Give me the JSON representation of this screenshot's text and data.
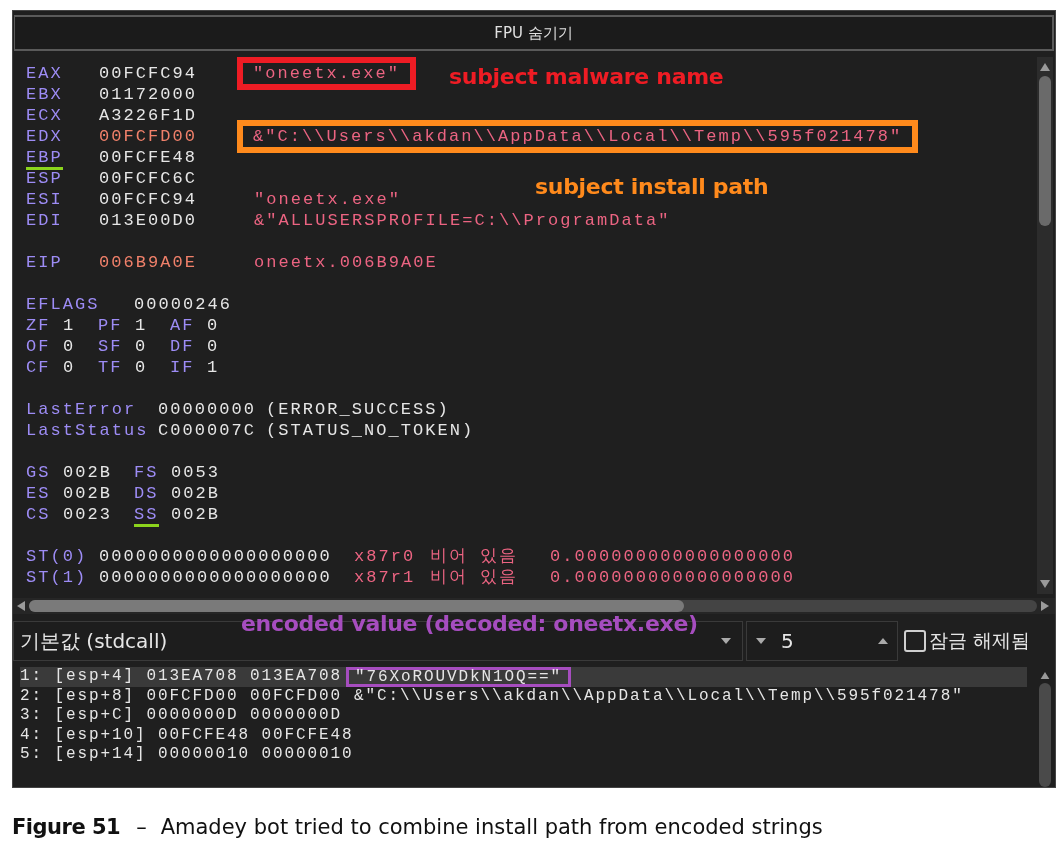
{
  "header": {
    "label": "FPU 숨기기"
  },
  "gpr": [
    {
      "name": "EAX",
      "value": "00FCFC94",
      "modified": false,
      "underlined": false,
      "comment": "\"oneetx.exe\"",
      "color": "#ee1c24"
    },
    {
      "name": "EBX",
      "value": "01172000",
      "modified": false,
      "underlined": false
    },
    {
      "name": "ECX",
      "value": "A3226F1D",
      "modified": false,
      "underlined": false
    },
    {
      "name": "EDX",
      "value": "00FCFD00",
      "modified": true,
      "underlined": false,
      "comment": "&\"C:\\\\Users\\\\akdan\\\\AppData\\\\Local\\\\Temp\\\\595f021478\"",
      "color": "#ff8a1c"
    },
    {
      "name": "EBP",
      "value": "00FCFE48",
      "modified": false,
      "underlined": true
    },
    {
      "name": "ESP",
      "value": "00FCFC6C",
      "modified": false,
      "underlined": false
    },
    {
      "name": "ESI",
      "value": "00FCFC94",
      "modified": false,
      "underlined": false,
      "comment": "\"oneetx.exe\""
    },
    {
      "name": "EDI",
      "value": "013E00D0",
      "modified": false,
      "underlined": false,
      "comment": "&\"ALLUSERSPROFILE=C:\\\\ProgramData\""
    }
  ],
  "eip": {
    "name": "EIP",
    "value": "006B9A0E",
    "modified": true,
    "comment": "oneetx.006B9A0E"
  },
  "eflags": {
    "name": "EFLAGS",
    "value": "00000246"
  },
  "flags": [
    [
      {
        "name": "ZF",
        "value": "1"
      },
      {
        "name": "PF",
        "value": "1"
      },
      {
        "name": "AF",
        "value": "0"
      }
    ],
    [
      {
        "name": "OF",
        "value": "0"
      },
      {
        "name": "SF",
        "value": "0"
      },
      {
        "name": "DF",
        "value": "0"
      }
    ],
    [
      {
        "name": "CF",
        "value": "0"
      },
      {
        "name": "TF",
        "value": "0"
      },
      {
        "name": "IF",
        "value": "1"
      }
    ]
  ],
  "last": [
    {
      "name": "LastError",
      "value": "00000000",
      "comment": "(ERROR_SUCCESS)"
    },
    {
      "name": "LastStatus",
      "value": "C000007C",
      "comment": "(STATUS_NO_TOKEN)"
    }
  ],
  "segments": [
    [
      {
        "name": "GS",
        "value": "002B",
        "underlined": false
      },
      {
        "name": "FS",
        "value": "0053",
        "underlined": false
      }
    ],
    [
      {
        "name": "ES",
        "value": "002B",
        "underlined": false
      },
      {
        "name": "DS",
        "value": "002B",
        "underlined": false
      }
    ],
    [
      {
        "name": "CS",
        "value": "0023",
        "underlined": false
      },
      {
        "name": "SS",
        "value": "002B",
        "underlined": true
      }
    ]
  ],
  "fpu": [
    {
      "name": "ST(0)",
      "value": "0000000000000000000",
      "reg": "x87r0",
      "tag": "비어 있음",
      "float": "0.000000000000000000"
    },
    {
      "name": "ST(1)",
      "value": "0000000000000000000",
      "reg": "x87r1",
      "tag": "비어 있음",
      "float": "0.000000000000000000"
    }
  ],
  "annotations": [
    {
      "label": "subject malware name",
      "color": "#ee1c24"
    },
    {
      "label": "subject install path",
      "color": "#ff8a1c"
    },
    {
      "label": "encoded value (decoded: oneetx.exe)",
      "color": "#a64dbf"
    }
  ],
  "toolbar": {
    "convention": "기본값 (stdcall)",
    "count": "5",
    "lock": {
      "label": "잠금 해제됨",
      "checked": false
    }
  },
  "stack": [
    {
      "line": "1: [esp+4] 013EA708 013EA708",
      "comment": "\"76XoROUVDkN1OQ==\"",
      "selected": true,
      "color": "#a64dbf"
    },
    {
      "line": "2: [esp+8] 00FCFD00 00FCFD00",
      "comment": "&\"C:\\\\Users\\\\akdan\\\\AppData\\\\Local\\\\Temp\\\\595f021478\"",
      "selected": false
    },
    {
      "line": "3: [esp+C] 0000000D 0000000D",
      "selected": false
    },
    {
      "line": "4: [esp+10] 00FCFE48 00FCFE48",
      "selected": false
    },
    {
      "line": "5: [esp+14] 00000010 00000010",
      "selected": false
    }
  ],
  "caption": {
    "figure": "Figure 51",
    "dash": "–",
    "text": "Amadey bot tried to combine install path from encoded strings"
  }
}
